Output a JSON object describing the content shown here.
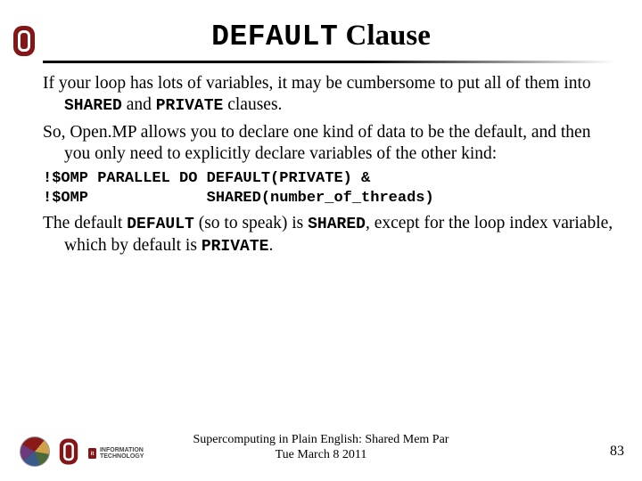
{
  "title": {
    "mono": "DEFAULT",
    "rest": " Clause"
  },
  "body": {
    "p1_a": "If your loop has lots of variables, it may be cumbersome to put all of them into ",
    "p1_code1": "SHARED",
    "p1_b": " and ",
    "p1_code2": "PRIVATE",
    "p1_c": " clauses.",
    "p2": "So, Open.MP allows you to declare one kind of data to be the default, and then you only need to explicitly declare variables of the other kind:",
    "code": "!$OMP PARALLEL DO DEFAULT(PRIVATE) &\n!$OMP             SHARED(number_of_threads)",
    "p3_a": "The default ",
    "p3_code1": "DEFAULT",
    "p3_b": " (so to speak) is ",
    "p3_code2": "SHARED",
    "p3_c": ", except for the loop index variable, which by default is ",
    "p3_code3": "PRIVATE",
    "p3_d": "."
  },
  "footer": {
    "line1": "Supercomputing in Plain English: Shared Mem Par",
    "line2": "Tue March 8 2011",
    "page": "83",
    "it_label": "INFORMATION\nTECHNOLOGY"
  },
  "icons": {
    "ou": "ou-logo",
    "pie": "pie-chart-logo",
    "it": "it-logo"
  },
  "colors": {
    "crimson": "#841617"
  }
}
